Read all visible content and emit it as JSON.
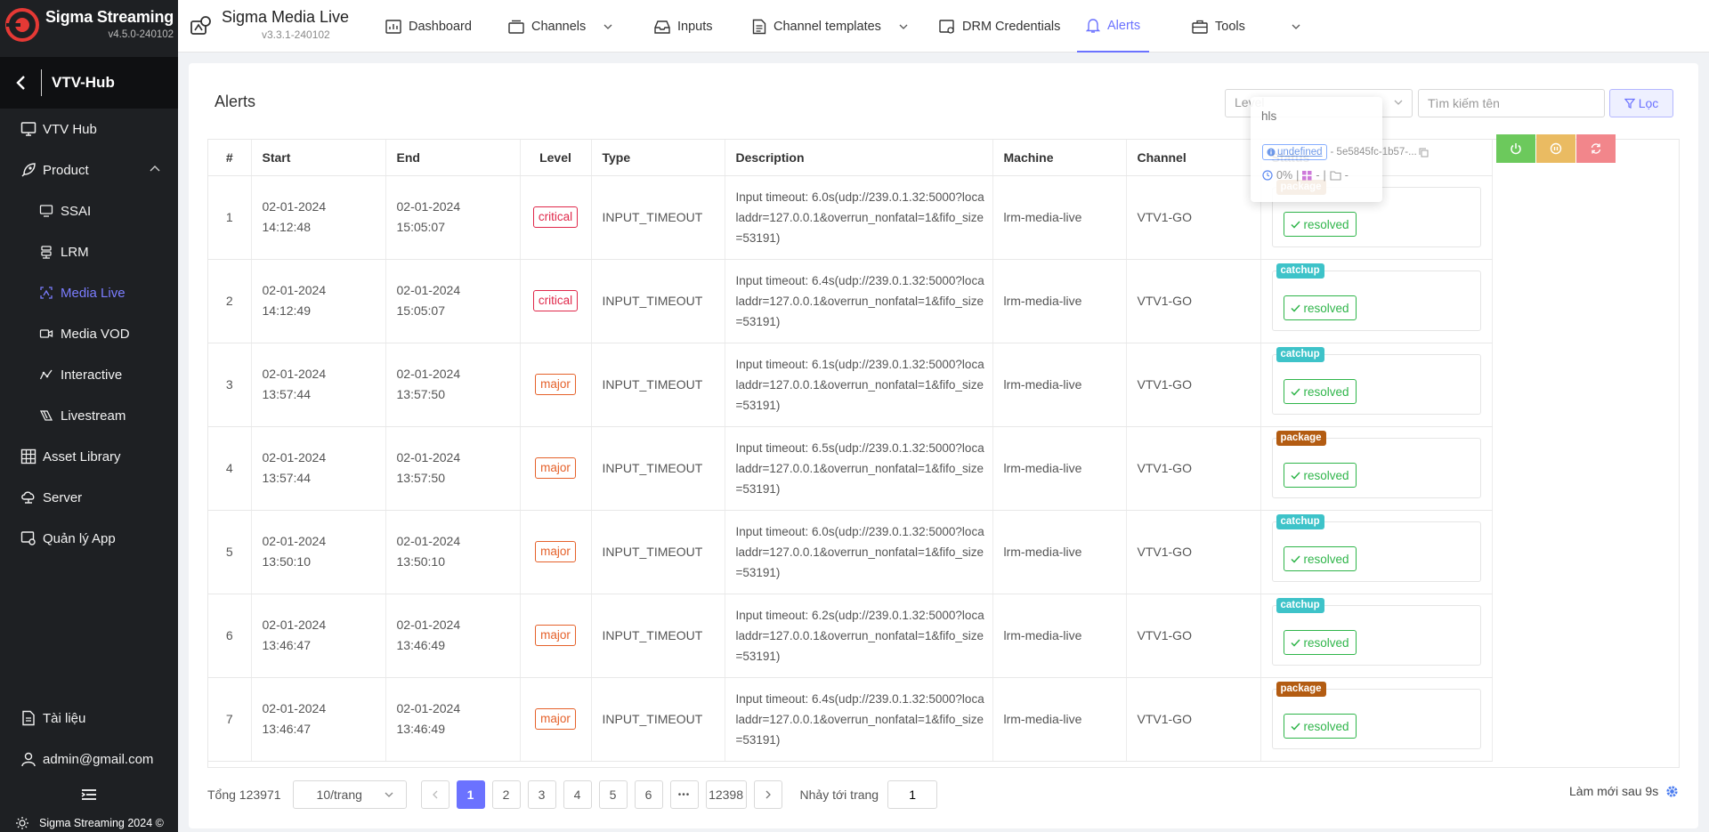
{
  "brand": {
    "name": "Sigma Streaming",
    "version": "v4.5.0-240102"
  },
  "hub": {
    "title": "VTV-Hub"
  },
  "nav": {
    "items": [
      {
        "label": "VTV Hub"
      },
      {
        "label": "Product"
      },
      {
        "label": "SSAI"
      },
      {
        "label": "LRM"
      },
      {
        "label": "Media Live"
      },
      {
        "label": "Media VOD"
      },
      {
        "label": "Interactive"
      },
      {
        "label": "Livestream"
      },
      {
        "label": "Asset Library"
      },
      {
        "label": "Server"
      },
      {
        "label": "Quản lý App"
      }
    ],
    "docs": "Tài liệu",
    "user": "admin@gmail.com",
    "copyright": "Sigma Streaming 2024 ©"
  },
  "app": {
    "name": "Sigma Media Live",
    "version": "v3.3.1-240102"
  },
  "tabs": [
    {
      "label": "Dashboard"
    },
    {
      "label": "Channels"
    },
    {
      "label": "Inputs"
    },
    {
      "label": "Channel templates"
    },
    {
      "label": "DRM Credentials"
    },
    {
      "label": "Alerts"
    },
    {
      "label": "Tools"
    }
  ],
  "page": {
    "title": "Alerts",
    "level_placeholder": "Level",
    "search_placeholder": "Tìm kiếm tên",
    "filter_label": "Lọc"
  },
  "table": {
    "headers": [
      "#",
      "Start",
      "End",
      "Level",
      "Type",
      "Description",
      "Machine",
      "Channel",
      "Status"
    ],
    "rows": [
      {
        "no": "1",
        "start_date": "02-01-2024",
        "start_time": "14:12:48",
        "end_date": "02-01-2024",
        "end_time": "15:05:07",
        "level": "critical",
        "type": "INPUT_TIMEOUT",
        "description": "Input timeout: 6.0s(udp://239.0.1.32:5000?localaddr=127.0.0.1&overrun_nonfatal=1&fifo_size=53191)",
        "machine": "lrm-media-live",
        "channel": "VTV1-GO",
        "tag": "package",
        "status": "resolved"
      },
      {
        "no": "2",
        "start_date": "02-01-2024",
        "start_time": "14:12:49",
        "end_date": "02-01-2024",
        "end_time": "15:05:07",
        "level": "critical",
        "type": "INPUT_TIMEOUT",
        "description": "Input timeout: 6.4s(udp://239.0.1.32:5000?localaddr=127.0.0.1&overrun_nonfatal=1&fifo_size=53191)",
        "machine": "lrm-media-live",
        "channel": "VTV1-GO",
        "tag": "catchup",
        "status": "resolved"
      },
      {
        "no": "3",
        "start_date": "02-01-2024",
        "start_time": "13:57:44",
        "end_date": "02-01-2024",
        "end_time": "13:57:50",
        "level": "major",
        "type": "INPUT_TIMEOUT",
        "description": "Input timeout: 6.1s(udp://239.0.1.32:5000?localaddr=127.0.0.1&overrun_nonfatal=1&fifo_size=53191)",
        "machine": "lrm-media-live",
        "channel": "VTV1-GO",
        "tag": "catchup",
        "status": "resolved"
      },
      {
        "no": "4",
        "start_date": "02-01-2024",
        "start_time": "13:57:44",
        "end_date": "02-01-2024",
        "end_time": "13:57:50",
        "level": "major",
        "type": "INPUT_TIMEOUT",
        "description": "Input timeout: 6.5s(udp://239.0.1.32:5000?localaddr=127.0.0.1&overrun_nonfatal=1&fifo_size=53191)",
        "machine": "lrm-media-live",
        "channel": "VTV1-GO",
        "tag": "package",
        "status": "resolved"
      },
      {
        "no": "5",
        "start_date": "02-01-2024",
        "start_time": "13:50:10",
        "end_date": "02-01-2024",
        "end_time": "13:50:10",
        "level": "major",
        "type": "INPUT_TIMEOUT",
        "description": "Input timeout: 6.0s(udp://239.0.1.32:5000?localaddr=127.0.0.1&overrun_nonfatal=1&fifo_size=53191)",
        "machine": "lrm-media-live",
        "channel": "VTV1-GO",
        "tag": "catchup",
        "status": "resolved"
      },
      {
        "no": "6",
        "start_date": "02-01-2024",
        "start_time": "13:46:47",
        "end_date": "02-01-2024",
        "end_time": "13:46:49",
        "level": "major",
        "type": "INPUT_TIMEOUT",
        "description": "Input timeout: 6.2s(udp://239.0.1.32:5000?localaddr=127.0.0.1&overrun_nonfatal=1&fifo_size=53191)",
        "machine": "lrm-media-live",
        "channel": "VTV1-GO",
        "tag": "catchup",
        "status": "resolved"
      },
      {
        "no": "7",
        "start_date": "02-01-2024",
        "start_time": "13:46:47",
        "end_date": "02-01-2024",
        "end_time": "13:46:49",
        "level": "major",
        "type": "INPUT_TIMEOUT",
        "description": "Input timeout: 6.4s(udp://239.0.1.32:5000?localaddr=127.0.0.1&overrun_nonfatal=1&fifo_size=53191)",
        "machine": "lrm-media-live",
        "channel": "VTV1-GO",
        "tag": "package",
        "status": "resolved"
      }
    ]
  },
  "popover": {
    "title": "hls",
    "pill": "undefined",
    "id": "- 5e5845fc-1b57-...",
    "progress": "0%",
    "dash1": "-",
    "dash2": "-"
  },
  "pagination": {
    "total": "Tổng 123971",
    "page_size": "10/trang",
    "pages": [
      "1",
      "2",
      "3",
      "4",
      "5",
      "6"
    ],
    "ellipsis": "•••",
    "last": "12398",
    "jump_label": "Nhảy tới trang",
    "jump_value": "1"
  },
  "refresh": {
    "label": "Làm mới sau 9s"
  },
  "colors": {
    "accent": "#6b72ff",
    "sidebar": "#1e2023",
    "critical": "#e0284a",
    "major": "#e5612a",
    "resolved": "#2fb54a",
    "catchup": "#3ec3c9",
    "package": "#b35c12"
  }
}
